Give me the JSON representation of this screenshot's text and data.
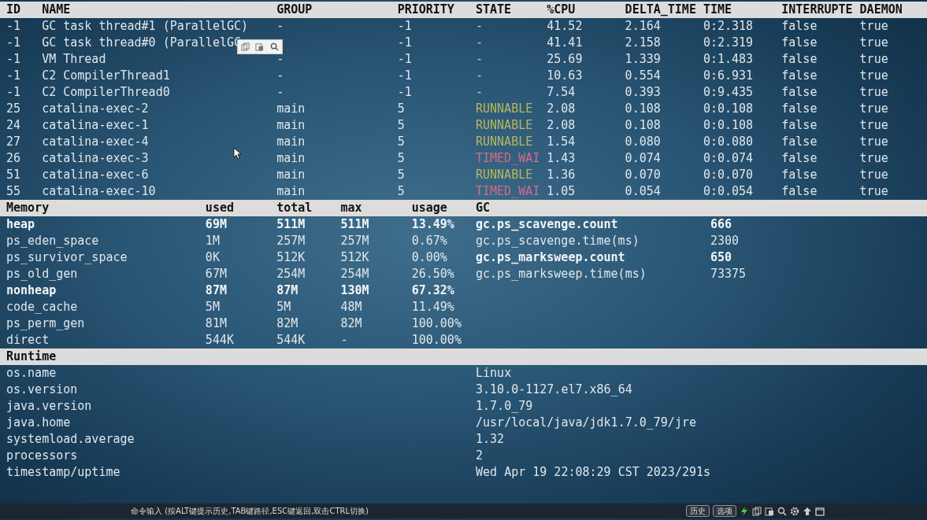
{
  "threads": {
    "columns": [
      "ID",
      "NAME",
      "GROUP",
      "PRIORITY",
      "STATE",
      "%CPU",
      "DELTA_TIME",
      "TIME",
      "INTERRUPTE",
      "DAEMON"
    ],
    "rows": [
      {
        "cells": [
          "-1",
          "GC task thread#1 (ParallelGC)",
          "-",
          "-1",
          "-",
          "41.52",
          "2.164",
          "0:2.318",
          "false",
          "true"
        ],
        "color": "#c8d0d6"
      },
      {
        "cells": [
          "-1",
          "GC task thread#0 (ParallelGC",
          "",
          "-1",
          "-",
          "41.41",
          "2.158",
          "0:2.319",
          "false",
          "true"
        ],
        "color": "#c8d0d6"
      },
      {
        "cells": [
          "-1",
          "VM Thread",
          "-",
          "-1",
          "-",
          "25.69",
          "1.339",
          "0:1.483",
          "false",
          "true"
        ],
        "color": "#c8d0d6"
      },
      {
        "cells": [
          "-1",
          "C2 CompilerThread1",
          "-",
          "-1",
          "-",
          "10.63",
          "0.554",
          "0:6.931",
          "false",
          "true"
        ],
        "color": "#c8d0d6"
      },
      {
        "cells": [
          "-1",
          "C2 CompilerThread0",
          "-",
          "-1",
          "-",
          "7.54",
          "0.393",
          "0:9.435",
          "false",
          "true"
        ],
        "color": "#c8d0d6"
      },
      {
        "cells": [
          "25",
          "catalina-exec-2",
          "main",
          "5",
          "RUNNABLE",
          "2.08",
          "0.108",
          "0:0.108",
          "false",
          "true"
        ],
        "color": "#b8b85a"
      },
      {
        "cells": [
          "24",
          "catalina-exec-1",
          "main",
          "5",
          "RUNNABLE",
          "2.08",
          "0.108",
          "0:0.108",
          "false",
          "true"
        ],
        "color": "#b8b85a"
      },
      {
        "cells": [
          "27",
          "catalina-exec-4",
          "main",
          "5",
          "RUNNABLE",
          "1.54",
          "0.080",
          "0:0.080",
          "false",
          "true"
        ],
        "color": "#b8b85a"
      },
      {
        "cells": [
          "26",
          "catalina-exec-3",
          "main",
          "5",
          "TIMED_WAI",
          "1.43",
          "0.074",
          "0:0.074",
          "false",
          "true"
        ],
        "color": "#d86a8a"
      },
      {
        "cells": [
          "51",
          "catalina-exec-6",
          "main",
          "5",
          "RUNNABLE",
          "1.36",
          "0.070",
          "0:0.070",
          "false",
          "true"
        ],
        "color": "#b8b85a"
      },
      {
        "cells": [
          "55",
          "catalina-exec-10",
          "main",
          "5",
          "TIMED_WAI",
          "1.05",
          "0.054",
          "0:0.054",
          "false",
          "true"
        ],
        "color": "#d86a8a"
      }
    ]
  },
  "memory": {
    "columns": [
      "Memory",
      "used",
      "total",
      "max",
      "usage",
      "GC"
    ],
    "rows": [
      {
        "cells": [
          "heap",
          "69M",
          "511M",
          "511M",
          "13.49%"
        ],
        "bold": true
      },
      {
        "cells": [
          "ps_eden_space",
          "1M",
          "257M",
          "257M",
          "0.67%"
        ],
        "bold": false
      },
      {
        "cells": [
          "ps_survivor_space",
          "0K",
          "512K",
          "512K",
          "0.00%"
        ],
        "bold": false
      },
      {
        "cells": [
          "ps_old_gen",
          "67M",
          "254M",
          "254M",
          "26.50%"
        ],
        "bold": false
      },
      {
        "cells": [
          "nonheap",
          "87M",
          "87M",
          "130M",
          "67.32%"
        ],
        "bold": true
      },
      {
        "cells": [
          "code_cache",
          "5M",
          "5M",
          "48M",
          "11.49%"
        ],
        "bold": false
      },
      {
        "cells": [
          "ps_perm_gen",
          "81M",
          "82M",
          "82M",
          "100.00%"
        ],
        "bold": false
      },
      {
        "cells": [
          "direct",
          "544K",
          "544K",
          "-",
          "100.00%"
        ],
        "bold": false
      }
    ],
    "gc": [
      {
        "name": "gc.ps_scavenge.count",
        "value": "666",
        "bold": true
      },
      {
        "name": "gc.ps_scavenge.time(ms)",
        "value": "2300",
        "bold": false
      },
      {
        "name": "gc.ps_marksweep.count",
        "value": "650",
        "bold": true
      },
      {
        "name": "gc.ps_marksweep.time(ms)",
        "value": "73375",
        "bold": false
      }
    ]
  },
  "runtime": {
    "title": "Runtime",
    "rows": [
      {
        "key": "os.name",
        "value": "Linux"
      },
      {
        "key": "os.version",
        "value": "3.10.0-1127.el7.x86_64"
      },
      {
        "key": "java.version",
        "value": "1.7.0_79"
      },
      {
        "key": "java.home",
        "value": "/usr/local/java/jdk1.7.0_79/jre"
      },
      {
        "key": "systemload.average",
        "value": "1.32"
      },
      {
        "key": "processors",
        "value": "2"
      },
      {
        "key": "timestamp/uptime",
        "value": "Wed Apr 19 22:08:29 CST 2023/291s"
      }
    ]
  },
  "command_bar": {
    "hint": "命令输入 (按ALT键提示历史,TAB键路径,ESC键返回,双击CTRL切换)",
    "buttons": [
      "历史",
      "选项"
    ]
  }
}
